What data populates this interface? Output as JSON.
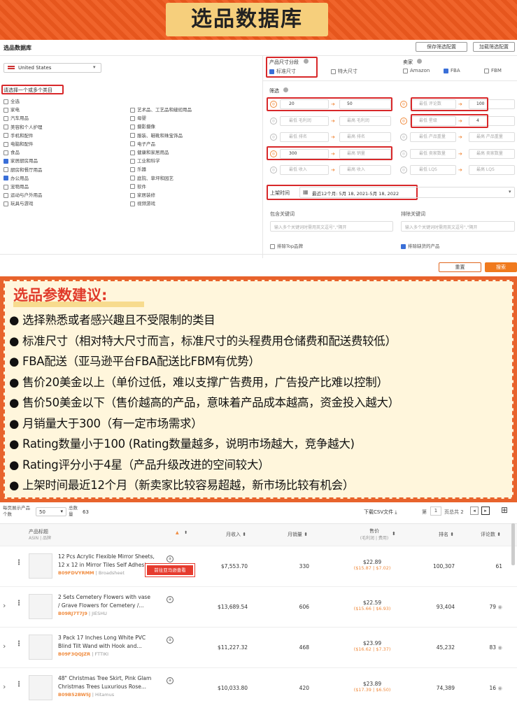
{
  "header": {
    "title": "选品数据库"
  },
  "screen": {
    "page_title": "选品数据库",
    "buttons": {
      "save": "保存筛选配置",
      "load": "加载筛选配置",
      "reset": "重置",
      "search": "搜索"
    },
    "market": "United States",
    "category_prompt": "请选择一个或多个类目",
    "categories_left": [
      {
        "label": "全选",
        "on": false
      },
      {
        "label": "家电",
        "on": false
      },
      {
        "label": "汽车用品",
        "on": false
      },
      {
        "label": "美容和个人护理",
        "on": false
      },
      {
        "label": "手机和配件",
        "on": false
      },
      {
        "label": "电脑和配件",
        "on": false
      },
      {
        "label": "食品",
        "on": false
      },
      {
        "label": "家居厨房用品",
        "on": true
      },
      {
        "label": "厨房和餐厅用品",
        "on": false
      },
      {
        "label": "办公用品",
        "on": true
      },
      {
        "label": "宠物用品",
        "on": false
      },
      {
        "label": "运动与户外用品",
        "on": false
      },
      {
        "label": "玩具与游戏",
        "on": false
      }
    ],
    "categories_right": [
      "艺术品、工艺品和缝纫用品",
      "母婴",
      "摄影摄像",
      "服装、鞋靴和珠宝饰品",
      "电子产品",
      "健康和家居用品",
      "工业和科学",
      "乐器",
      "庭院、草坪和园艺",
      "软件",
      "家居装修",
      "视频游戏"
    ],
    "size": {
      "label": "产品尺寸分段",
      "standard": "标准尺寸",
      "oversize": "特大尺寸"
    },
    "seller": {
      "label": "卖家",
      "amazon": "Amazon",
      "fba": "FBA",
      "fbm": "FBM"
    },
    "filter_label": "筛选",
    "filters_left": [
      {
        "min": "20",
        "max": "50"
      },
      {
        "min": "最低 毛利润",
        "max": "最高 毛利润"
      },
      {
        "min": "最低 排名",
        "max": "最高 排名"
      },
      {
        "min": "300",
        "max": "最高 销量"
      },
      {
        "min": "最低 收入",
        "max": "最高 收入"
      }
    ],
    "filters_right": [
      {
        "min": "最低 评论数",
        "max": "100"
      },
      {
        "min": "最低 星级",
        "max": "4"
      },
      {
        "min": "最低 产品重量",
        "max": "最高 产品重量"
      },
      {
        "min": "最低 卖家数量",
        "max": "最高 卖家数量"
      },
      {
        "min": "最低 LQS",
        "max": "最高 LQS"
      }
    ],
    "date": {
      "label": "上架时间",
      "value": "最近12个月: 5月 18, 2021-5月 18, 2022"
    },
    "include_kw": {
      "label": "包含关键词",
      "placeholder": "输入多个关键词时需用英文逗号\",\"隔开"
    },
    "exclude_kw": {
      "label": "排除关键词",
      "placeholder": "输入多个关键词时需用英文逗号\",\"隔开"
    },
    "exclude_top": "排除Top品牌",
    "exclude_missing": "排除缺货的产品"
  },
  "advice": {
    "title": "选品参数建议:",
    "lines": [
      "● 选择熟悉或者感兴趣且不受限制的类目",
      "● 标准尺寸（相对特大尺寸而言，标准尺寸的头程费用仓储费和配送费较低）",
      "● FBA配送（亚马逊平台FBA配送比FBM有优势）",
      "● 售价20美金以上（单价过低，难以支撑广告费用，广告投产比难以控制）",
      "● 售价50美金以下（售价越高的产品，意味着产品成本越高，资金投入越大）",
      "● 月销量大于300（有一定市场需求）",
      "● Rating数量小于100 (Rating数量越多，说明市场越大，竞争越大)",
      "● Rating评分小于4星（产品升级改进的空间较大）",
      "● 上架时间最近12个月（新卖家比较容易超越，新市场比较有机会）"
    ]
  },
  "table": {
    "per_page_label_1": "每页展示产品",
    "per_page_label_2": "个数",
    "per_page": "50",
    "total_label_1": "总数",
    "total_label_2": "量",
    "total": "63",
    "csv": "下载CSV文件",
    "page_label": "第",
    "page": "1",
    "page_total": "页总共 2",
    "cols": {
      "title": "产品标题",
      "title_sub": "ASIN | 品牌",
      "revenue": "月收入",
      "sales": "月销量",
      "price": "售价",
      "price_sub": "(毛利润 | 费用)",
      "rank": "排名",
      "reviews": "评论数"
    },
    "tooltip": "前往亚马逊查看",
    "rows": [
      {
        "t1": "12 Pcs Acrylic Flexible Mirror Sheets,",
        "t2": "12 x 12 in Mirror Tiles Self Adhesive",
        "asin": "B09FDVYRMM",
        "brand": "| Broadsheet",
        "rev": "$7,553.70",
        "sales": "330",
        "price": "$22.89",
        "sub": "($15.87 | $7.02)",
        "rank": "100,307",
        "rev_n": "61"
      },
      {
        "t1": "2 Sets Cemetery Flowers with vase",
        "t2": "/ Grave Flowers for Cemetery /...",
        "asin": "B09RJ7T7J9",
        "brand": "| JIESHU",
        "rev": "$13,689.54",
        "sales": "606",
        "price": "$22.59",
        "sub": "($15.66 | $6.93)",
        "rank": "93,404",
        "rev_n": "79"
      },
      {
        "t1": "3 Pack 17 Inches Long White PVC",
        "t2": "Blind Tilt Wand with Hook and...",
        "asin": "B09F3QQJZR",
        "brand": "| FTTIKI",
        "rev": "$11,227.32",
        "sales": "468",
        "price": "$23.99",
        "sub": "($16.62 | $7.37)",
        "rank": "45,232",
        "rev_n": "83"
      },
      {
        "t1": "48\" Christmas Tree Skirt, Pink Glam",
        "t2": "Christmas Trees Luxurious Rose...",
        "asin": "B09B52BW5J",
        "brand": "| Hitamus",
        "rev": "$10,033.80",
        "sales": "420",
        "price": "$23.89",
        "sub": "($17.39 | $6.50)",
        "rank": "74,389",
        "rev_n": "16"
      }
    ]
  }
}
